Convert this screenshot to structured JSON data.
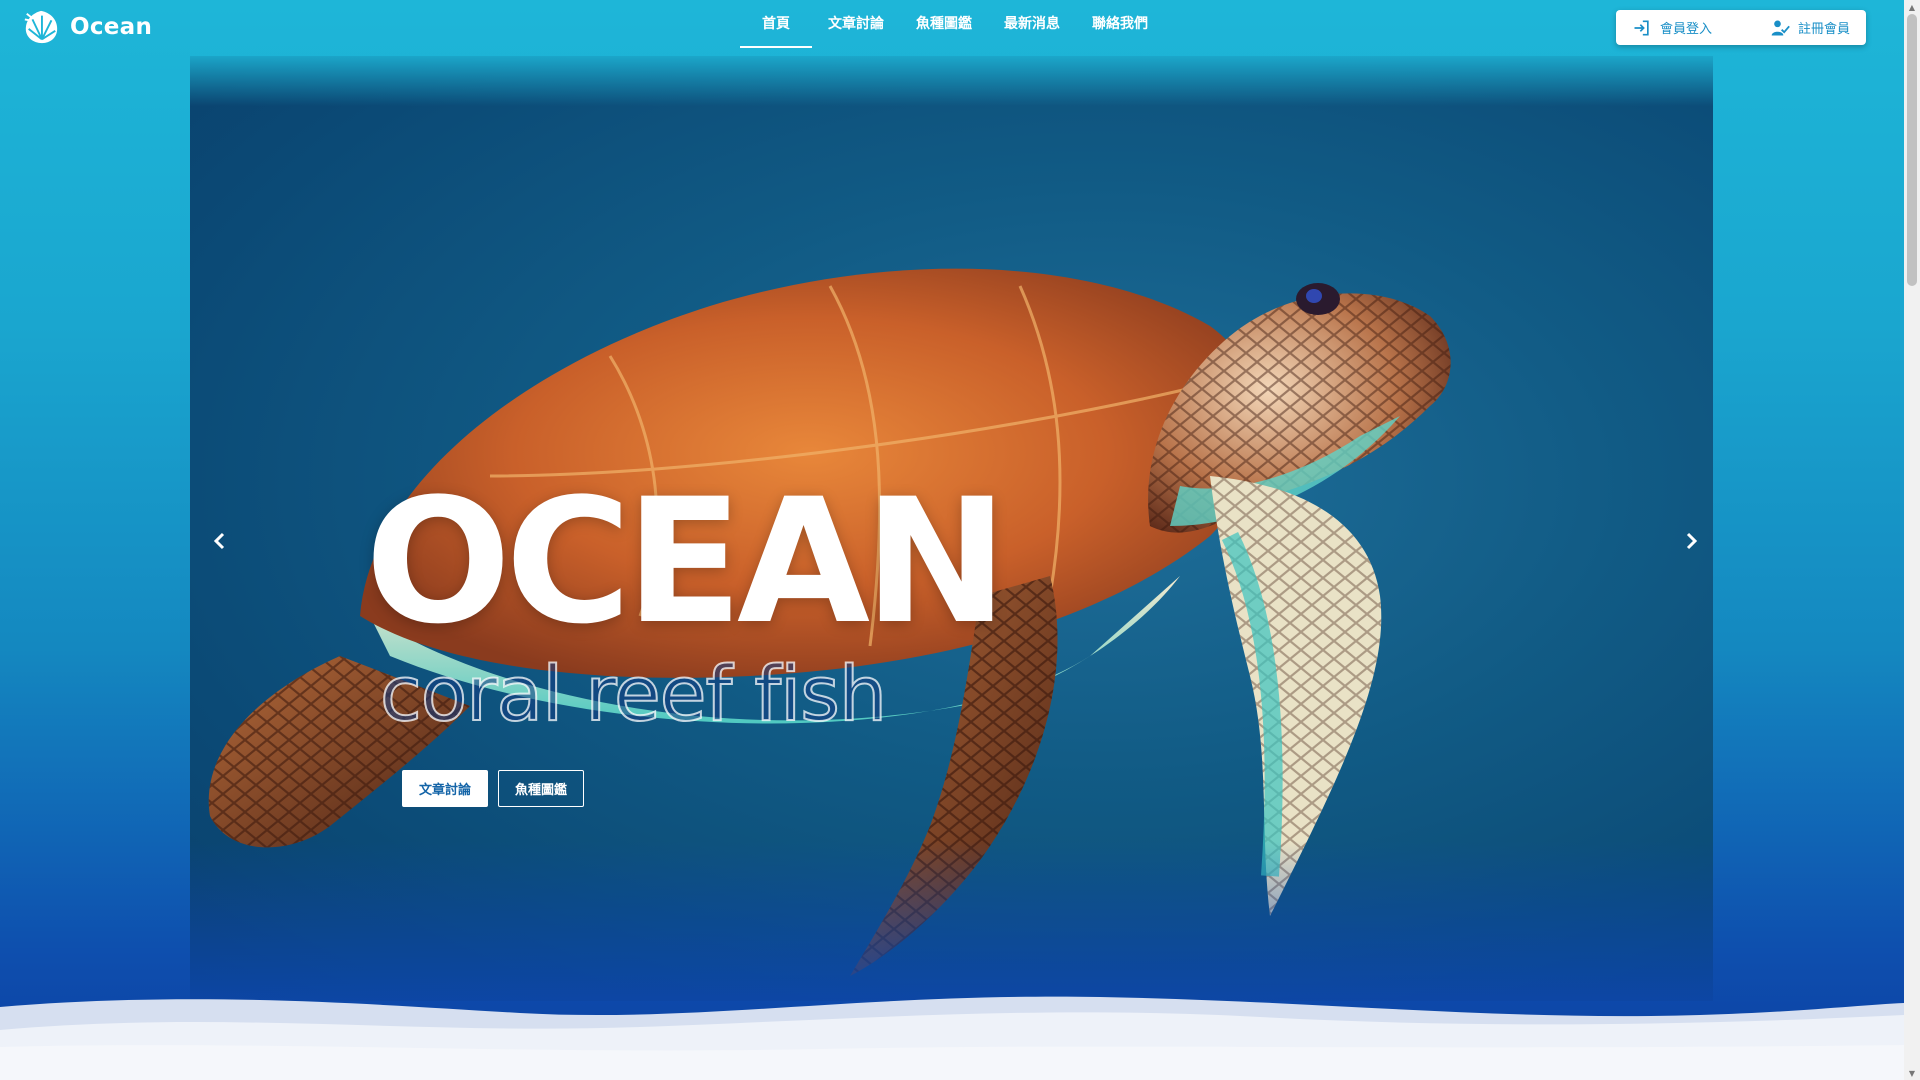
{
  "brand": {
    "name": "Ocean",
    "logo_icon": "shell-logo-icon"
  },
  "nav": {
    "items": [
      {
        "label": "首頁",
        "active": true
      },
      {
        "label": "文章討論",
        "active": false
      },
      {
        "label": "魚種圖鑑",
        "active": false
      },
      {
        "label": "最新消息",
        "active": false
      },
      {
        "label": "聯絡我們",
        "active": false
      }
    ]
  },
  "auth": {
    "login_label": "會員登入",
    "login_icon": "login-arrow-icon",
    "register_label": "註冊會員",
    "register_icon": "user-check-icon"
  },
  "hero": {
    "title": "OCEAN",
    "subtitle": "coral reef fish",
    "buttons": [
      {
        "label": "文章討論",
        "style": "solid"
      },
      {
        "label": "魚種圖鑑",
        "style": "outline"
      }
    ],
    "prev_icon": "chevron-left-icon",
    "next_icon": "chevron-right-icon"
  },
  "colors": {
    "header_top": "#1eb6d8",
    "page_bottom": "#0c3fa3",
    "accent": "#1a8fc7",
    "wave_light": "#f5f7fb"
  }
}
